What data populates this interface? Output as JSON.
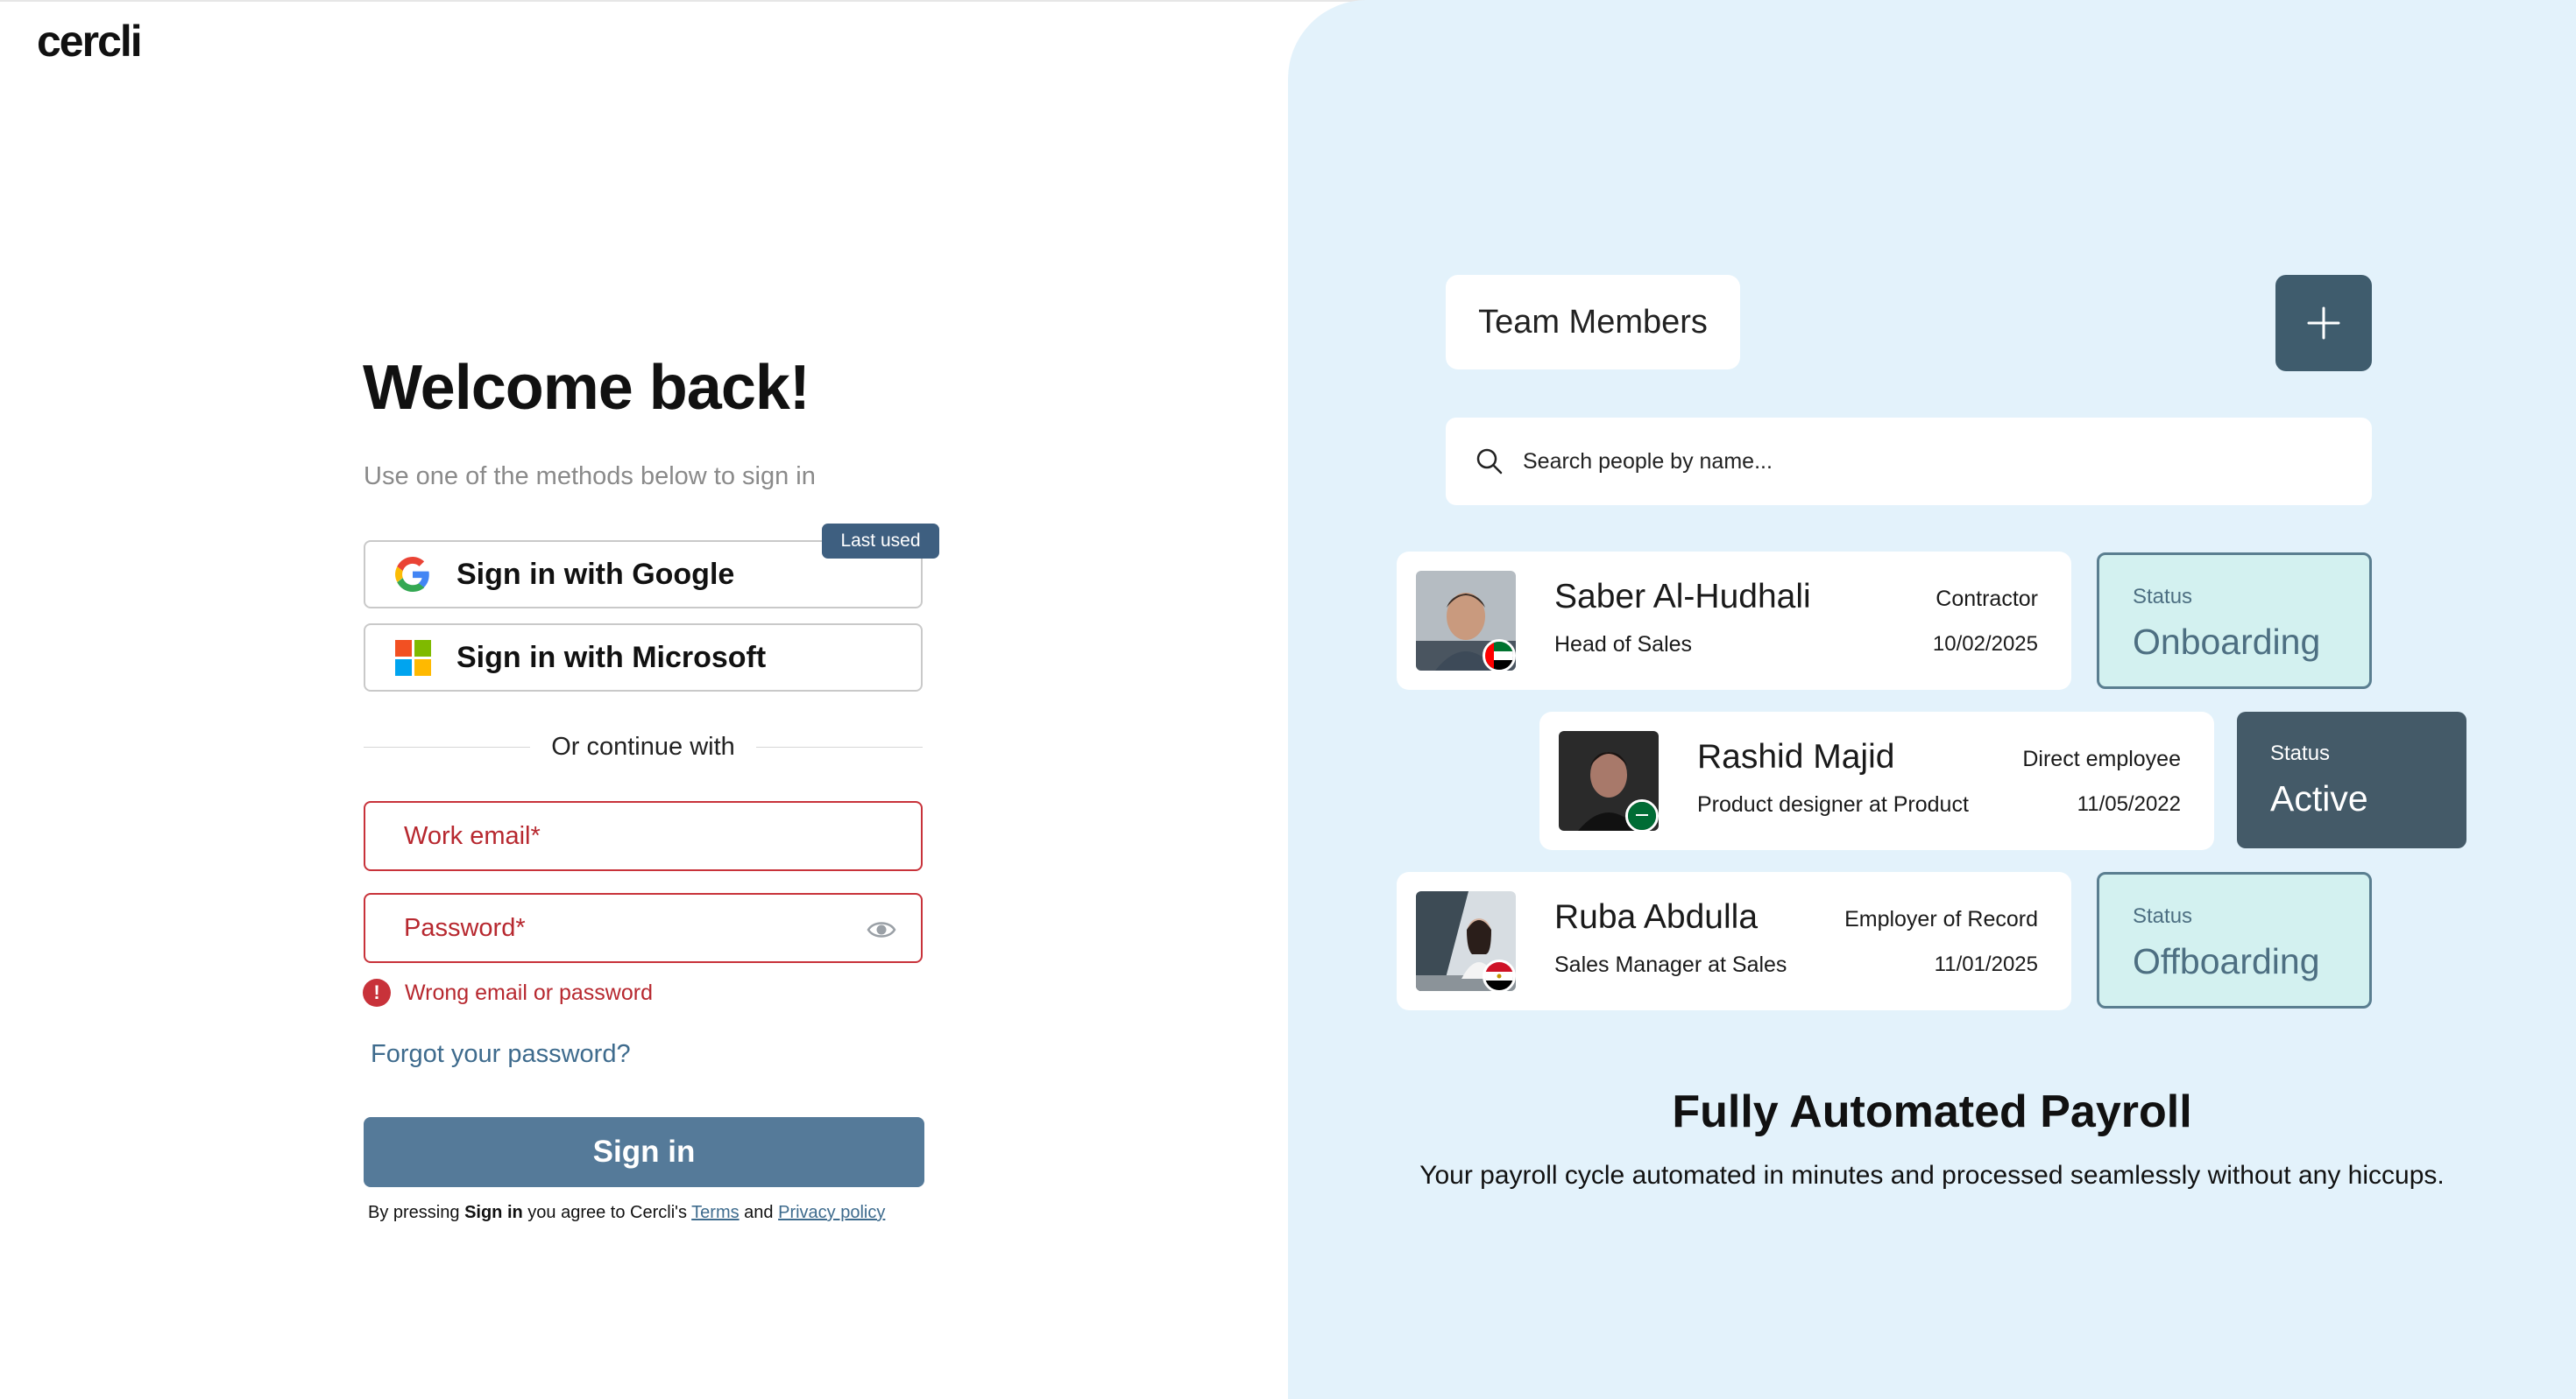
{
  "brand": {
    "logo_text": "cercli"
  },
  "login": {
    "title": "Welcome back!",
    "subtitle": "Use one of the methods below to sign in",
    "google_label": "Sign in with Google",
    "microsoft_label": "Sign in with Microsoft",
    "last_used_badge": "Last used",
    "divider_text": "Or continue with",
    "email_placeholder": "Work email*",
    "password_placeholder": "Password*",
    "error_text": "Wrong email or password",
    "forgot_label": "Forgot your password?",
    "signin_label": "Sign in",
    "legal": {
      "prefix": "By pressing ",
      "bold": "Sign in",
      "middle": " you agree to Cercli's ",
      "terms": "Terms",
      "and": " and ",
      "privacy": "Privacy policy"
    }
  },
  "panel": {
    "team_title": "Team Members",
    "add_icon": "plus-icon",
    "search_placeholder": "Search people by name...",
    "members": [
      {
        "name": "Saber Al-Hudhali",
        "role": "Head of Sales",
        "type": "Contractor",
        "date": "10/02/2025",
        "status_label": "Status",
        "status": "Onboarding"
      },
      {
        "name": "Rashid Majid",
        "role": "Product designer at Product",
        "type": "Direct employee",
        "date": "11/05/2022",
        "status_label": "Status",
        "status": "Active"
      },
      {
        "name": "Ruba Abdulla",
        "role": "Sales Manager at Sales",
        "type": "Employer of Record",
        "date": "11/01/2025",
        "status_label": "Status",
        "status": "Offboarding"
      }
    ],
    "feature_title": "Fully Automated Payroll",
    "feature_subtitle": "Your payroll cycle automated in minutes and processed seamlessly without any hiccups."
  },
  "colors": {
    "primary_button": "#557a99",
    "error": "#c8323a",
    "panel_bg": "#e3f2fb",
    "status_dark": "#445a68"
  }
}
